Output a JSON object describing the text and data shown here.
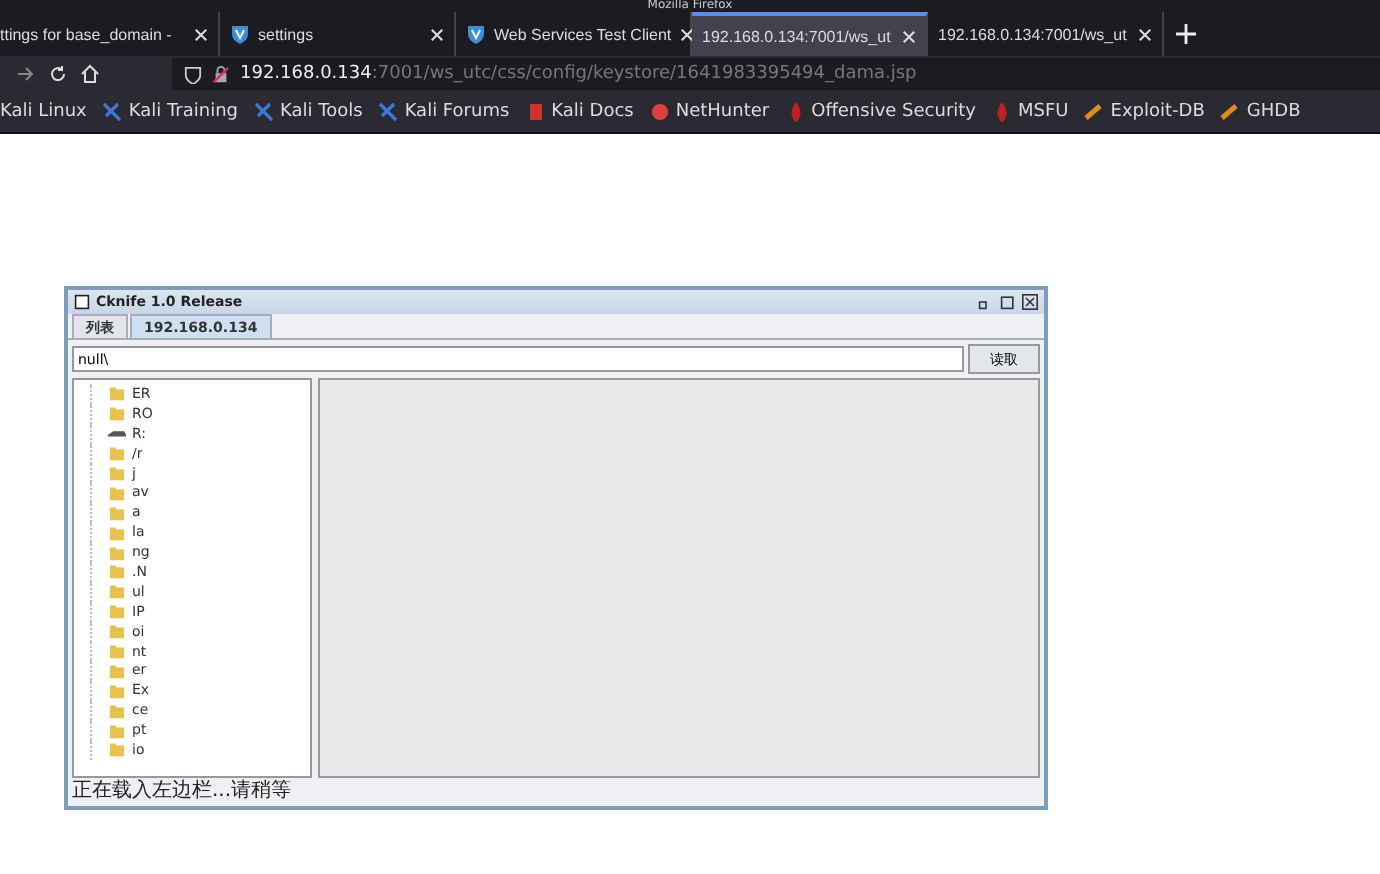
{
  "window": {
    "title": "Mozilla Firefox"
  },
  "tabs": [
    {
      "label": "ttings for base_domain -",
      "favicon": false,
      "selected": false
    },
    {
      "label": "settings",
      "favicon": true,
      "selected": false
    },
    {
      "label": "Web Services Test Client",
      "favicon": true,
      "selected": false
    },
    {
      "label": "192.168.0.134:7001/ws_ut",
      "favicon": false,
      "selected": true
    },
    {
      "label": "192.168.0.134:7001/ws_ut",
      "favicon": false,
      "selected": false
    }
  ],
  "address_bar": {
    "host": "192.168.0.134",
    "path": ":7001/ws_utc/css/config/keystore/1641983395494_dama.jsp"
  },
  "bookmarks": [
    {
      "label": "Kali Linux",
      "kind": "none"
    },
    {
      "label": "Kali Training",
      "kind": "kali"
    },
    {
      "label": "Kali Tools",
      "kind": "kali"
    },
    {
      "label": "Kali Forums",
      "kind": "kali"
    },
    {
      "label": "Kali Docs",
      "kind": "docs"
    },
    {
      "label": "NetHunter",
      "kind": "nethunter"
    },
    {
      "label": "Offensive Security",
      "kind": "offsec"
    },
    {
      "label": "MSFU",
      "kind": "offsec"
    },
    {
      "label": "Exploit-DB",
      "kind": "exploit"
    },
    {
      "label": "GHDB",
      "kind": "exploit"
    }
  ],
  "app": {
    "title": "Cknife 1.0 Release",
    "tabs": [
      {
        "label": "列表",
        "selected": false
      },
      {
        "label": "192.168.0.134",
        "selected": true
      }
    ],
    "path_field": {
      "value": "null\\"
    },
    "read_button": "读取",
    "tree": [
      {
        "label": "ER",
        "kind": "folder"
      },
      {
        "label": "RO",
        "kind": "folder"
      },
      {
        "label": "R:",
        "kind": "drive"
      },
      {
        "label": "/r",
        "kind": "folder"
      },
      {
        "label": "j",
        "kind": "folder"
      },
      {
        "label": "av",
        "kind": "folder"
      },
      {
        "label": "a",
        "kind": "folder"
      },
      {
        "label": "la",
        "kind": "folder"
      },
      {
        "label": "ng",
        "kind": "folder"
      },
      {
        "label": ".N",
        "kind": "folder"
      },
      {
        "label": "ul",
        "kind": "folder"
      },
      {
        "label": "IP",
        "kind": "folder"
      },
      {
        "label": "oi",
        "kind": "folder"
      },
      {
        "label": "nt",
        "kind": "folder"
      },
      {
        "label": "er",
        "kind": "folder"
      },
      {
        "label": "Ex",
        "kind": "folder"
      },
      {
        "label": "ce",
        "kind": "folder"
      },
      {
        "label": "pt",
        "kind": "folder"
      },
      {
        "label": "io",
        "kind": "folder"
      }
    ],
    "status": "正在载入左边栏...请稍等"
  }
}
